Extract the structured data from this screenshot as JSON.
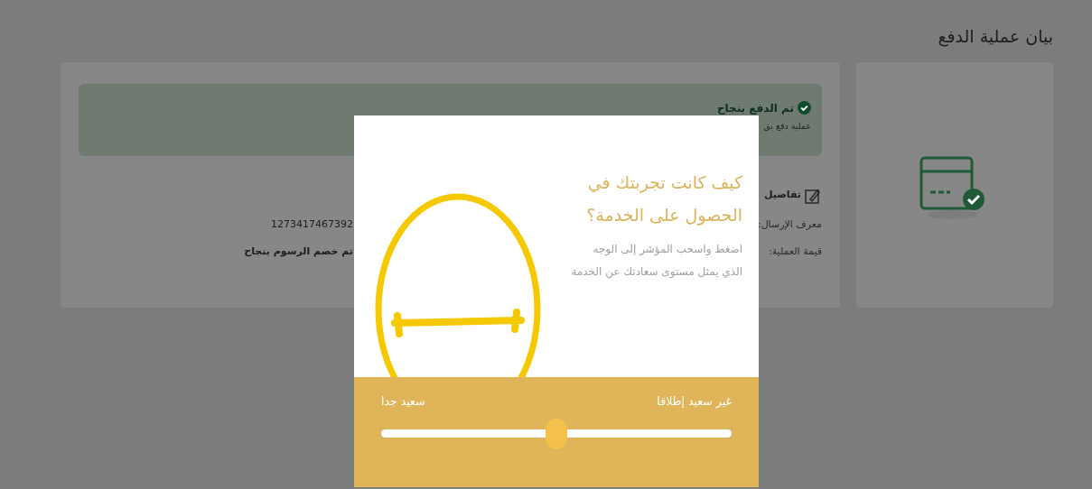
{
  "page": {
    "title": "بيان عملية الدفع"
  },
  "alert": {
    "title": "تم الدفع بنجاح",
    "text": "عملية دفع بق"
  },
  "details": {
    "heading": "تفاصيل",
    "rows": [
      {
        "label": "معرف الإرسال:",
        "value": "1273417467392"
      },
      {
        "label": "قيمة العملية:",
        "value": "تم خصم الرسوم بنجاح"
      }
    ]
  },
  "survey": {
    "title": "كيف كانت تجربتك في الحصول على الخدمة؟",
    "instructions": "اضغط واسحب المؤشر إلى الوجه الذي يمثل مستوى سعادتك عن الخدمة",
    "min_label": "غير سعيد إطلاقا",
    "max_label": "سعيد جدا",
    "level": 0.5
  }
}
